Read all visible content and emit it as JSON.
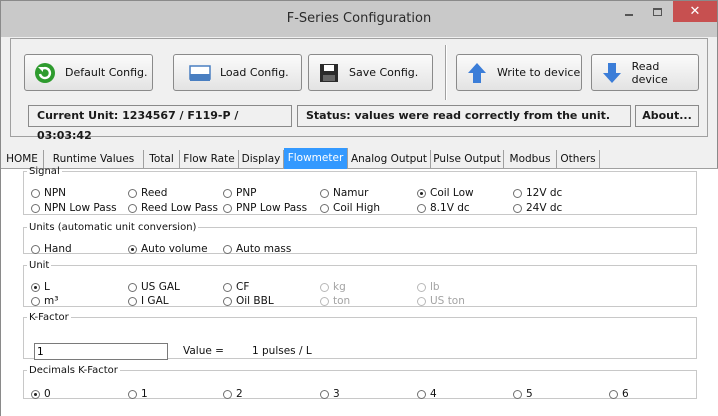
{
  "window": {
    "title": "F-Series Configuration",
    "close_color": "#c75050"
  },
  "toolbar": {
    "default_label": "Default Config.",
    "load_label": "Load Config.",
    "save_label": "Save Config.",
    "write_label": "Write to device",
    "read_label": "Read device",
    "current_unit": "Current Unit: 1234567 / F119-P / 03:03:42",
    "status": "Status: values were read correctly from the unit.",
    "about_label": "About..."
  },
  "tabs": [
    {
      "label": "HOME",
      "active": false
    },
    {
      "label": "Runtime Values",
      "active": false
    },
    {
      "label": "Total",
      "active": false
    },
    {
      "label": "Flow Rate",
      "active": false
    },
    {
      "label": "Display",
      "active": false
    },
    {
      "label": "Flowmeter",
      "active": true
    },
    {
      "label": "Analog Output",
      "active": false
    },
    {
      "label": "Pulse Output",
      "active": false
    },
    {
      "label": "Modbus",
      "active": false
    },
    {
      "label": "Others",
      "active": false
    }
  ],
  "signal": {
    "legend": "Signal",
    "options": [
      {
        "label": "NPN",
        "checked": false,
        "enabled": true
      },
      {
        "label": "Reed",
        "checked": false,
        "enabled": true
      },
      {
        "label": "PNP",
        "checked": false,
        "enabled": true
      },
      {
        "label": "Namur",
        "checked": false,
        "enabled": true
      },
      {
        "label": "Coil Low",
        "checked": true,
        "enabled": true
      },
      {
        "label": "12V dc",
        "checked": false,
        "enabled": true
      },
      {
        "label": "NPN Low Pass",
        "checked": false,
        "enabled": true
      },
      {
        "label": "Reed Low Pass",
        "checked": false,
        "enabled": true
      },
      {
        "label": "PNP Low Pass",
        "checked": false,
        "enabled": true
      },
      {
        "label": "Coil High",
        "checked": false,
        "enabled": true
      },
      {
        "label": "8.1V dc",
        "checked": false,
        "enabled": true
      },
      {
        "label": "24V dc",
        "checked": false,
        "enabled": true
      }
    ]
  },
  "units_mode": {
    "legend": "Units (automatic unit conversion)",
    "options": [
      {
        "label": "Hand",
        "checked": false,
        "enabled": true
      },
      {
        "label": "Auto volume",
        "checked": true,
        "enabled": true
      },
      {
        "label": "Auto mass",
        "checked": false,
        "enabled": true
      }
    ]
  },
  "unit": {
    "legend": "Unit",
    "options": [
      {
        "label": "L",
        "checked": true,
        "enabled": true
      },
      {
        "label": "US GAL",
        "checked": false,
        "enabled": true
      },
      {
        "label": "CF",
        "checked": false,
        "enabled": true
      },
      {
        "label": "kg",
        "checked": false,
        "enabled": false
      },
      {
        "label": "lb",
        "checked": false,
        "enabled": false
      },
      {
        "label": "m³",
        "checked": false,
        "enabled": true
      },
      {
        "label": "I GAL",
        "checked": false,
        "enabled": true
      },
      {
        "label": "Oil BBL",
        "checked": false,
        "enabled": true
      },
      {
        "label": "ton",
        "checked": false,
        "enabled": false
      },
      {
        "label": "US ton",
        "checked": false,
        "enabled": false
      }
    ]
  },
  "kfactor": {
    "legend": "K-Factor",
    "input_value": "1",
    "value_label": "Value =",
    "value_text": "1 pulses / L"
  },
  "decimals": {
    "legend": "Decimals K-Factor",
    "options": [
      {
        "label": "0",
        "checked": true,
        "enabled": true
      },
      {
        "label": "1",
        "checked": false,
        "enabled": true
      },
      {
        "label": "2",
        "checked": false,
        "enabled": true
      },
      {
        "label": "3",
        "checked": false,
        "enabled": true
      },
      {
        "label": "4",
        "checked": false,
        "enabled": true
      },
      {
        "label": "5",
        "checked": false,
        "enabled": true
      },
      {
        "label": "6",
        "checked": false,
        "enabled": true
      }
    ]
  }
}
